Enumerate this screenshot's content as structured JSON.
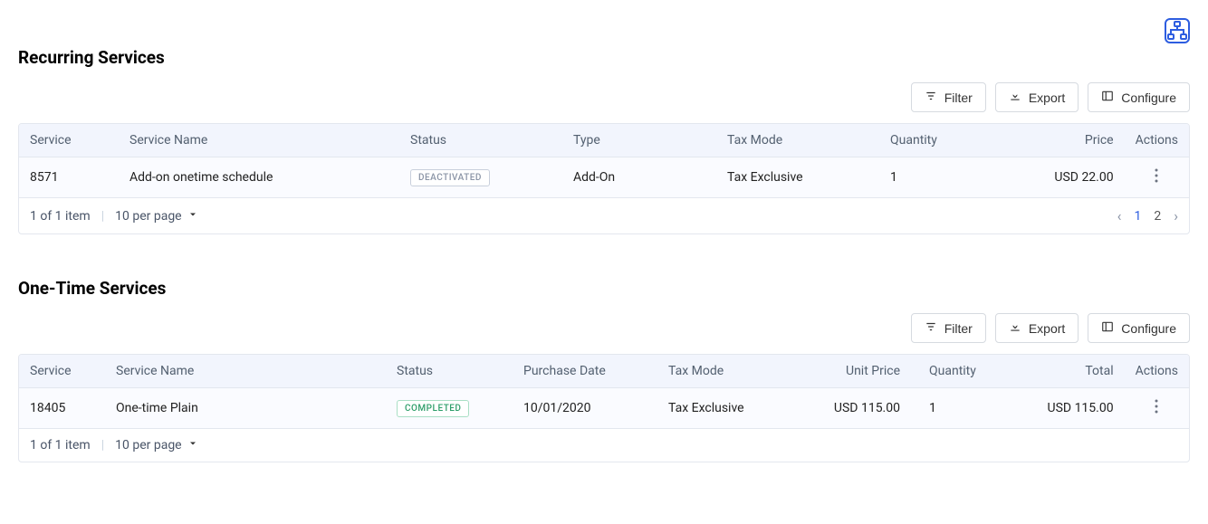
{
  "toolbar": {
    "filter": "Filter",
    "export": "Export",
    "configure": "Configure"
  },
  "sections": {
    "recurring": {
      "title": "Recurring Services",
      "columns": {
        "service": "Service",
        "serviceName": "Service Name",
        "status": "Status",
        "type": "Type",
        "taxMode": "Tax Mode",
        "quantity": "Quantity",
        "price": "Price",
        "actions": "Actions"
      },
      "rows": [
        {
          "service": "8571",
          "serviceName": "Add-on onetime schedule",
          "status": "DEACTIVATED",
          "type": "Add-On",
          "taxMode": "Tax Exclusive",
          "quantity": "1",
          "price": "USD 22.00"
        }
      ],
      "footer": {
        "summary": "1 of 1 item",
        "perPage": "10 per page",
        "pageCurrent": "1",
        "pageOther": "2"
      }
    },
    "onetime": {
      "title": "One-Time Services",
      "columns": {
        "service": "Service",
        "serviceName": "Service Name",
        "status": "Status",
        "purchaseDate": "Purchase Date",
        "taxMode": "Tax Mode",
        "unitPrice": "Unit Price",
        "quantity": "Quantity",
        "total": "Total",
        "actions": "Actions"
      },
      "rows": [
        {
          "service": "18405",
          "serviceName": "One-time Plain",
          "status": "COMPLETED",
          "purchaseDate": "10/01/2020",
          "taxMode": "Tax Exclusive",
          "unitPrice": "USD 115.00",
          "quantity": "1",
          "total": "USD 115.00"
        }
      ],
      "footer": {
        "summary": "1 of 1 item",
        "perPage": "10 per page"
      }
    }
  }
}
